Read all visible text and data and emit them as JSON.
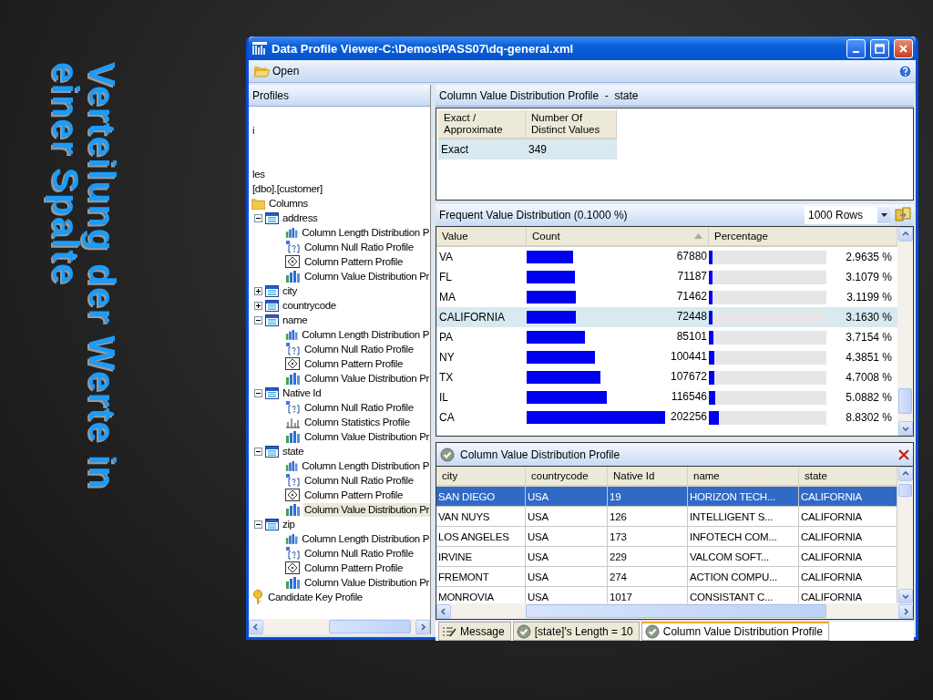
{
  "slide_title": "Verteilung der Werte in einer Spalte",
  "window": {
    "title": "Data Profile Viewer-C:\\Demos\\PASS07\\dq-general.xml"
  },
  "toolbar": {
    "open_button": "Open"
  },
  "profiles_pane": {
    "title": "Profiles",
    "tree": [
      {
        "label": "i",
        "kind": "text",
        "selected": false
      },
      {
        "label": "les",
        "kind": "text",
        "selected": false
      },
      {
        "label": "[dbo].[customer]",
        "kind": "text",
        "selected": false
      },
      {
        "label": "Columns",
        "kind": "folder",
        "selected": false,
        "children": [
          {
            "label": "address",
            "kind": "column",
            "expanded": true,
            "selected": false,
            "children": [
              {
                "label": "Column Length Distribution P",
                "kind": "length",
                "selected": false
              },
              {
                "label": "Column Null Ratio Profile",
                "kind": "null",
                "selected": false
              },
              {
                "label": "Column Pattern Profile",
                "kind": "pattern",
                "selected": false
              },
              {
                "label": "Column Value Distribution Pr",
                "kind": "value",
                "selected": false
              }
            ]
          },
          {
            "label": "city",
            "kind": "column",
            "expanded": false,
            "selected": false
          },
          {
            "label": "countrycode",
            "kind": "column",
            "expanded": false,
            "selected": false
          },
          {
            "label": "name",
            "kind": "column",
            "expanded": true,
            "selected": false,
            "children": [
              {
                "label": "Column Length Distribution P",
                "kind": "length",
                "selected": false
              },
              {
                "label": "Column Null Ratio Profile",
                "kind": "null",
                "selected": false
              },
              {
                "label": "Column Pattern Profile",
                "kind": "pattern",
                "selected": false
              },
              {
                "label": "Column Value Distribution Pr",
                "kind": "value",
                "selected": false
              }
            ]
          },
          {
            "label": "Native Id",
            "kind": "column",
            "expanded": true,
            "selected": false,
            "children": [
              {
                "label": "Column Null Ratio Profile",
                "kind": "null",
                "selected": false
              },
              {
                "label": "Column Statistics Profile",
                "kind": "stats",
                "selected": false
              },
              {
                "label": "Column Value Distribution Pr",
                "kind": "value",
                "selected": false
              }
            ]
          },
          {
            "label": "state",
            "kind": "column",
            "expanded": true,
            "selected": false,
            "children": [
              {
                "label": "Column Length Distribution P",
                "kind": "length",
                "selected": false
              },
              {
                "label": "Column Null Ratio Profile",
                "kind": "null",
                "selected": false
              },
              {
                "label": "Column Pattern Profile",
                "kind": "pattern",
                "selected": false
              },
              {
                "label": "Column Value Distribution Pr",
                "kind": "value",
                "selected": true
              }
            ]
          },
          {
            "label": "zip",
            "kind": "column",
            "expanded": true,
            "selected": false,
            "children": [
              {
                "label": "Column Length Distribution P",
                "kind": "length",
                "selected": false
              },
              {
                "label": "Column Null Ratio Profile",
                "kind": "null",
                "selected": false
              },
              {
                "label": "Column Pattern Profile",
                "kind": "pattern",
                "selected": false
              },
              {
                "label": "Column Value Distribution Pr",
                "kind": "value",
                "selected": false
              }
            ]
          }
        ]
      },
      {
        "label": "Candidate Key Profile",
        "kind": "key",
        "selected": false
      }
    ]
  },
  "profile_pane": {
    "title": "Column Value Distribution Profile  -  state",
    "summary_table": {
      "columns": [
        "Exact / Approximate",
        "Number Of Distinct Values"
      ],
      "rows": [
        {
          "cells": [
            "Exact",
            "349"
          ],
          "selected": true
        }
      ]
    },
    "frequent": {
      "title": "Frequent Value Distribution (0.1000 %)",
      "rows_dropdown": "1000 Rows",
      "columns": [
        "Value",
        "Count",
        "Percentage"
      ],
      "rows": [
        {
          "value": "VA",
          "count": "67880",
          "percent_bar": {
            "level": 0.0296
          },
          "percentage": "2.9635 %",
          "selected": false
        },
        {
          "value": "FL",
          "count": "71187",
          "percent_bar": {
            "level": 0.0311
          },
          "percentage": "3.1079 %",
          "selected": false
        },
        {
          "value": "MA",
          "count": "71462",
          "percent_bar": {
            "level": 0.0312
          },
          "percentage": "3.1199 %",
          "selected": false
        },
        {
          "value": "CALIFORNIA",
          "count": "72448",
          "percent_bar": {
            "level": 0.0316
          },
          "percentage": "3.1630 %",
          "selected": true
        },
        {
          "value": "PA",
          "count": "85101",
          "percent_bar": {
            "level": 0.0372
          },
          "percentage": "3.7154 %",
          "selected": false
        },
        {
          "value": "NY",
          "count": "100441",
          "percent_bar": {
            "level": 0.0439
          },
          "percentage": "4.3851 %",
          "selected": false
        },
        {
          "value": "TX",
          "count": "107672",
          "percent_bar": {
            "level": 0.047
          },
          "percentage": "4.7008 %",
          "selected": false
        },
        {
          "value": "IL",
          "count": "116546",
          "percent_bar": {
            "level": 0.0509
          },
          "percentage": "5.0882 %",
          "selected": false
        },
        {
          "value": "CA",
          "count": "202256",
          "percent_bar": {
            "level": 0.0883
          },
          "percentage": "8.8302 %",
          "selected": false
        }
      ]
    },
    "drilldown": {
      "title": "Column Value Distribution Profile",
      "columns": [
        "city",
        "countrycode",
        "Native Id",
        "name",
        "state"
      ],
      "rows": [
        {
          "cells": [
            "SAN DIEGO",
            "USA",
            "19",
            "HORIZON TECH...",
            "CALIFORNIA"
          ],
          "selected": true
        },
        {
          "cells": [
            "VAN NUYS",
            "USA",
            "126",
            "INTELLIGENT S...",
            "CALIFORNIA"
          ],
          "selected": false
        },
        {
          "cells": [
            "LOS ANGELES",
            "USA",
            "173",
            "INFOTECH COM...",
            "CALIFORNIA"
          ],
          "selected": false
        },
        {
          "cells": [
            "IRVINE",
            "USA",
            "229",
            "VALCOM SOFT...",
            "CALIFORNIA"
          ],
          "selected": false
        },
        {
          "cells": [
            "FREMONT",
            "USA",
            "274",
            "ACTION COMPU...",
            "CALIFORNIA"
          ],
          "selected": false
        },
        {
          "cells": [
            "MONROVIA",
            "USA",
            "1017",
            "CONSISTANT C...",
            "CALIFORNIA"
          ],
          "selected": false
        }
      ]
    }
  },
  "tabs": [
    {
      "label": "Message",
      "kind": "message",
      "selected": false
    },
    {
      "label": "[state]'s Length = 10",
      "kind": "check",
      "selected": false
    },
    {
      "label": "Column Value Distribution Profile",
      "kind": "check",
      "selected": true
    }
  ]
}
